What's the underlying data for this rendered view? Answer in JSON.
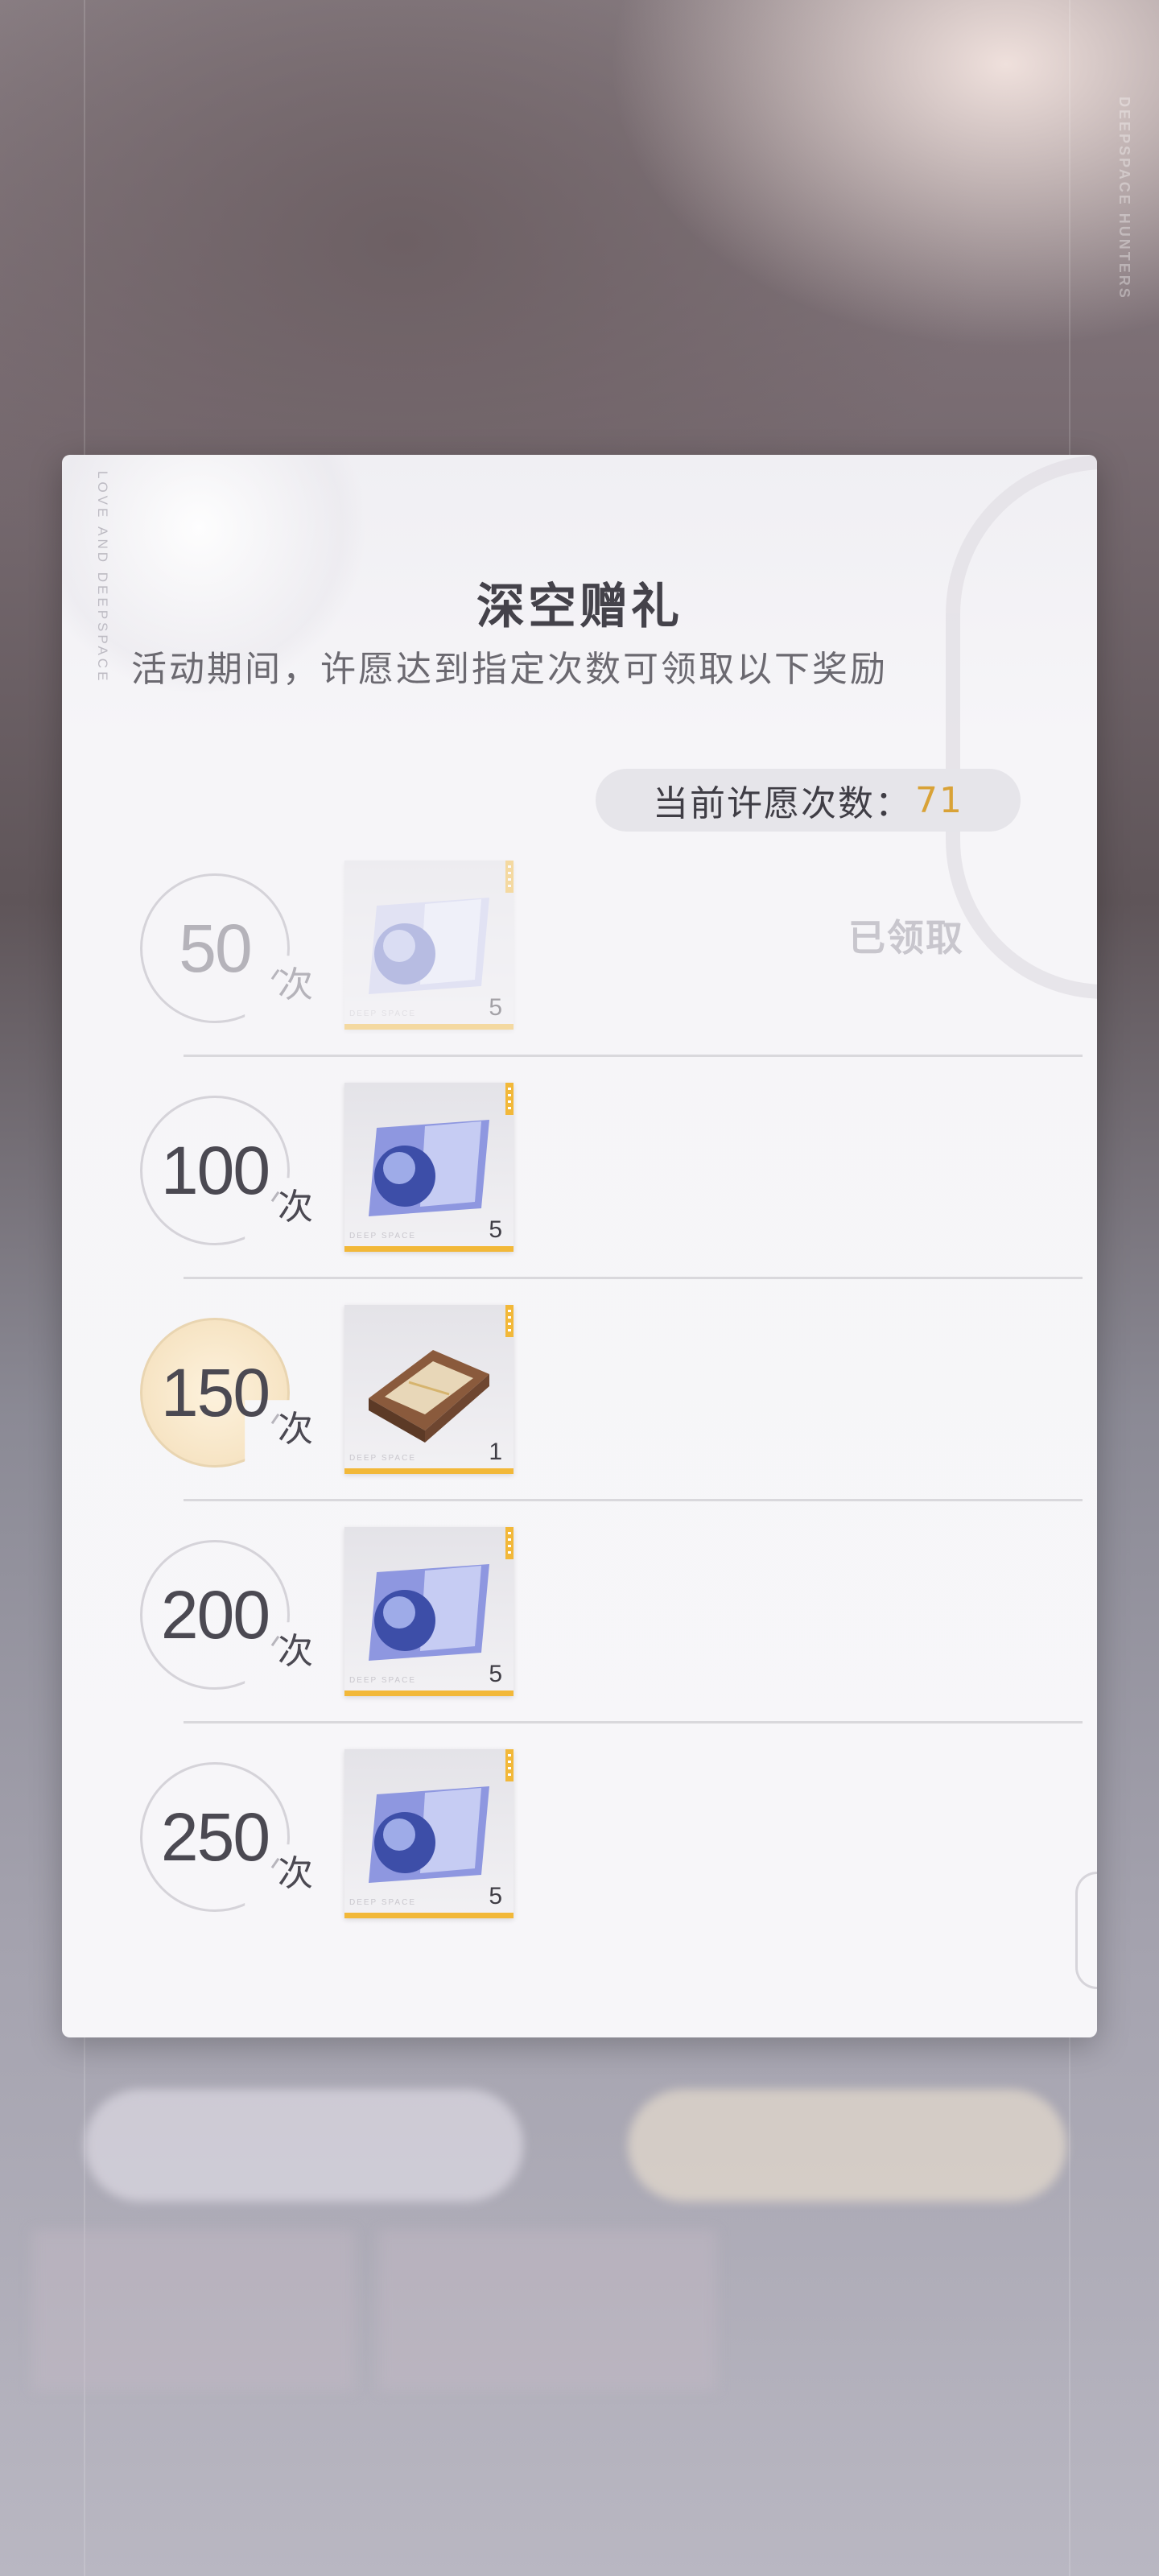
{
  "background": {
    "side_label": "DEEPSPACE HUNTERS"
  },
  "panel": {
    "side_text": "LOVE AND DEEPSPACE",
    "title": "深空赠礼",
    "subtitle": "活动期间，许愿达到指定次数可领取以下奖励",
    "counter_label": "当前许愿次数：",
    "counter_value": "71"
  },
  "milestones": [
    {
      "count": "50",
      "unit": "次",
      "item_icon": "deepspace-ticket-icon",
      "quantity": "5",
      "brand": "DEEP SPACE",
      "status": "已领取",
      "claimed": true
    },
    {
      "count": "100",
      "unit": "次",
      "item_icon": "deepspace-ticket-icon",
      "quantity": "5",
      "brand": "DEEP SPACE",
      "status": "",
      "claimed": false
    },
    {
      "count": "150",
      "unit": "次",
      "item_icon": "gift-box-icon",
      "quantity": "1",
      "brand": "DEEP SPACE",
      "status": "",
      "claimed": false,
      "highlight": true
    },
    {
      "count": "200",
      "unit": "次",
      "item_icon": "deepspace-ticket-icon",
      "quantity": "5",
      "brand": "DEEP SPACE",
      "status": "",
      "claimed": false
    },
    {
      "count": "250",
      "unit": "次",
      "item_icon": "deepspace-ticket-icon",
      "quantity": "5",
      "brand": "DEEP SPACE",
      "status": "",
      "claimed": false
    }
  ],
  "colors": {
    "accent": "#d9a237",
    "rarity_bar": "#f2b839",
    "title": "#44424a"
  }
}
